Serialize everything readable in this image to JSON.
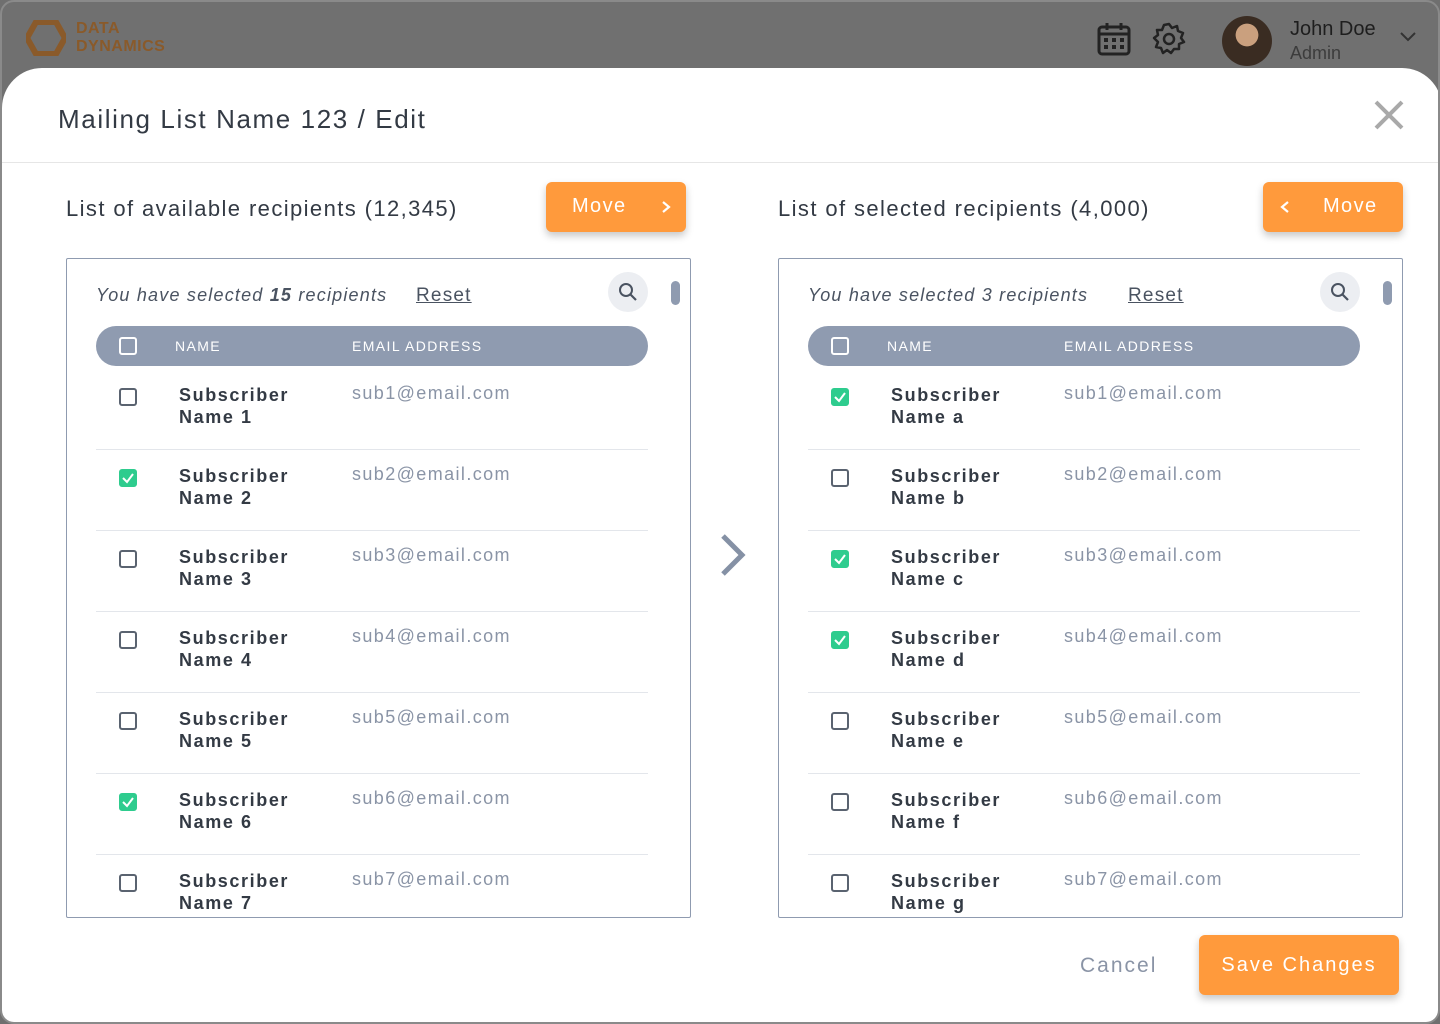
{
  "app": {
    "logo_line1": "DATA",
    "logo_line2": "DYNAMICS",
    "user_name": "John Doe",
    "user_role": "Admin",
    "icons": [
      "calendar-icon",
      "gear-icon",
      "chevron-down-icon"
    ]
  },
  "modal": {
    "title": "Mailing List Name 123 / Edit",
    "close_icon": "close-icon",
    "cancel_label": "Cancel",
    "save_label": "Save Changes"
  },
  "colors": {
    "accent": "#ff9a3c",
    "header_bg": "#8f9bb0",
    "checked": "#2ecc8e"
  },
  "available": {
    "title": "List of available recipients (12,345)",
    "move_label": "Move",
    "sel_prefix": "You have selected ",
    "sel_count": "15",
    "sel_suffix": " recipients",
    "reset_label": "Reset",
    "col_name": "NAME",
    "col_email": "EMAIL ADDRESS",
    "rows": [
      {
        "name": "Subscriber Name 1",
        "email": "sub1@email.com",
        "checked": false
      },
      {
        "name": "Subscriber Name 2",
        "email": "sub2@email.com",
        "checked": true
      },
      {
        "name": "Subscriber Name 3",
        "email": "sub3@email.com",
        "checked": false
      },
      {
        "name": "Subscriber Name 4",
        "email": "sub4@email.com",
        "checked": false
      },
      {
        "name": "Subscriber Name 5",
        "email": "sub5@email.com",
        "checked": false
      },
      {
        "name": "Subscriber Name 6",
        "email": "sub6@email.com",
        "checked": true
      },
      {
        "name": "Subscriber Name 7",
        "email": "sub7@email.com",
        "checked": false
      }
    ]
  },
  "selected": {
    "title": "List of selected recipients (4,000)",
    "move_label": "Move",
    "sel_prefix": "You have selected ",
    "sel_count": "3",
    "sel_suffix": " recipients",
    "reset_label": "Reset",
    "col_name": "NAME",
    "col_email": "EMAIL ADDRESS",
    "rows": [
      {
        "name": "Subscriber Name a",
        "email": "sub1@email.com",
        "checked": true
      },
      {
        "name": "Subscriber Name b",
        "email": "sub2@email.com",
        "checked": false
      },
      {
        "name": "Subscriber Name c",
        "email": "sub3@email.com",
        "checked": true
      },
      {
        "name": "Subscriber Name d",
        "email": "sub4@email.com",
        "checked": true
      },
      {
        "name": "Subscriber Name e",
        "email": "sub5@email.com",
        "checked": false
      },
      {
        "name": "Subscriber Name f",
        "email": "sub6@email.com",
        "checked": false
      },
      {
        "name": "Subscriber Name g",
        "email": "sub7@email.com",
        "checked": false
      }
    ]
  }
}
